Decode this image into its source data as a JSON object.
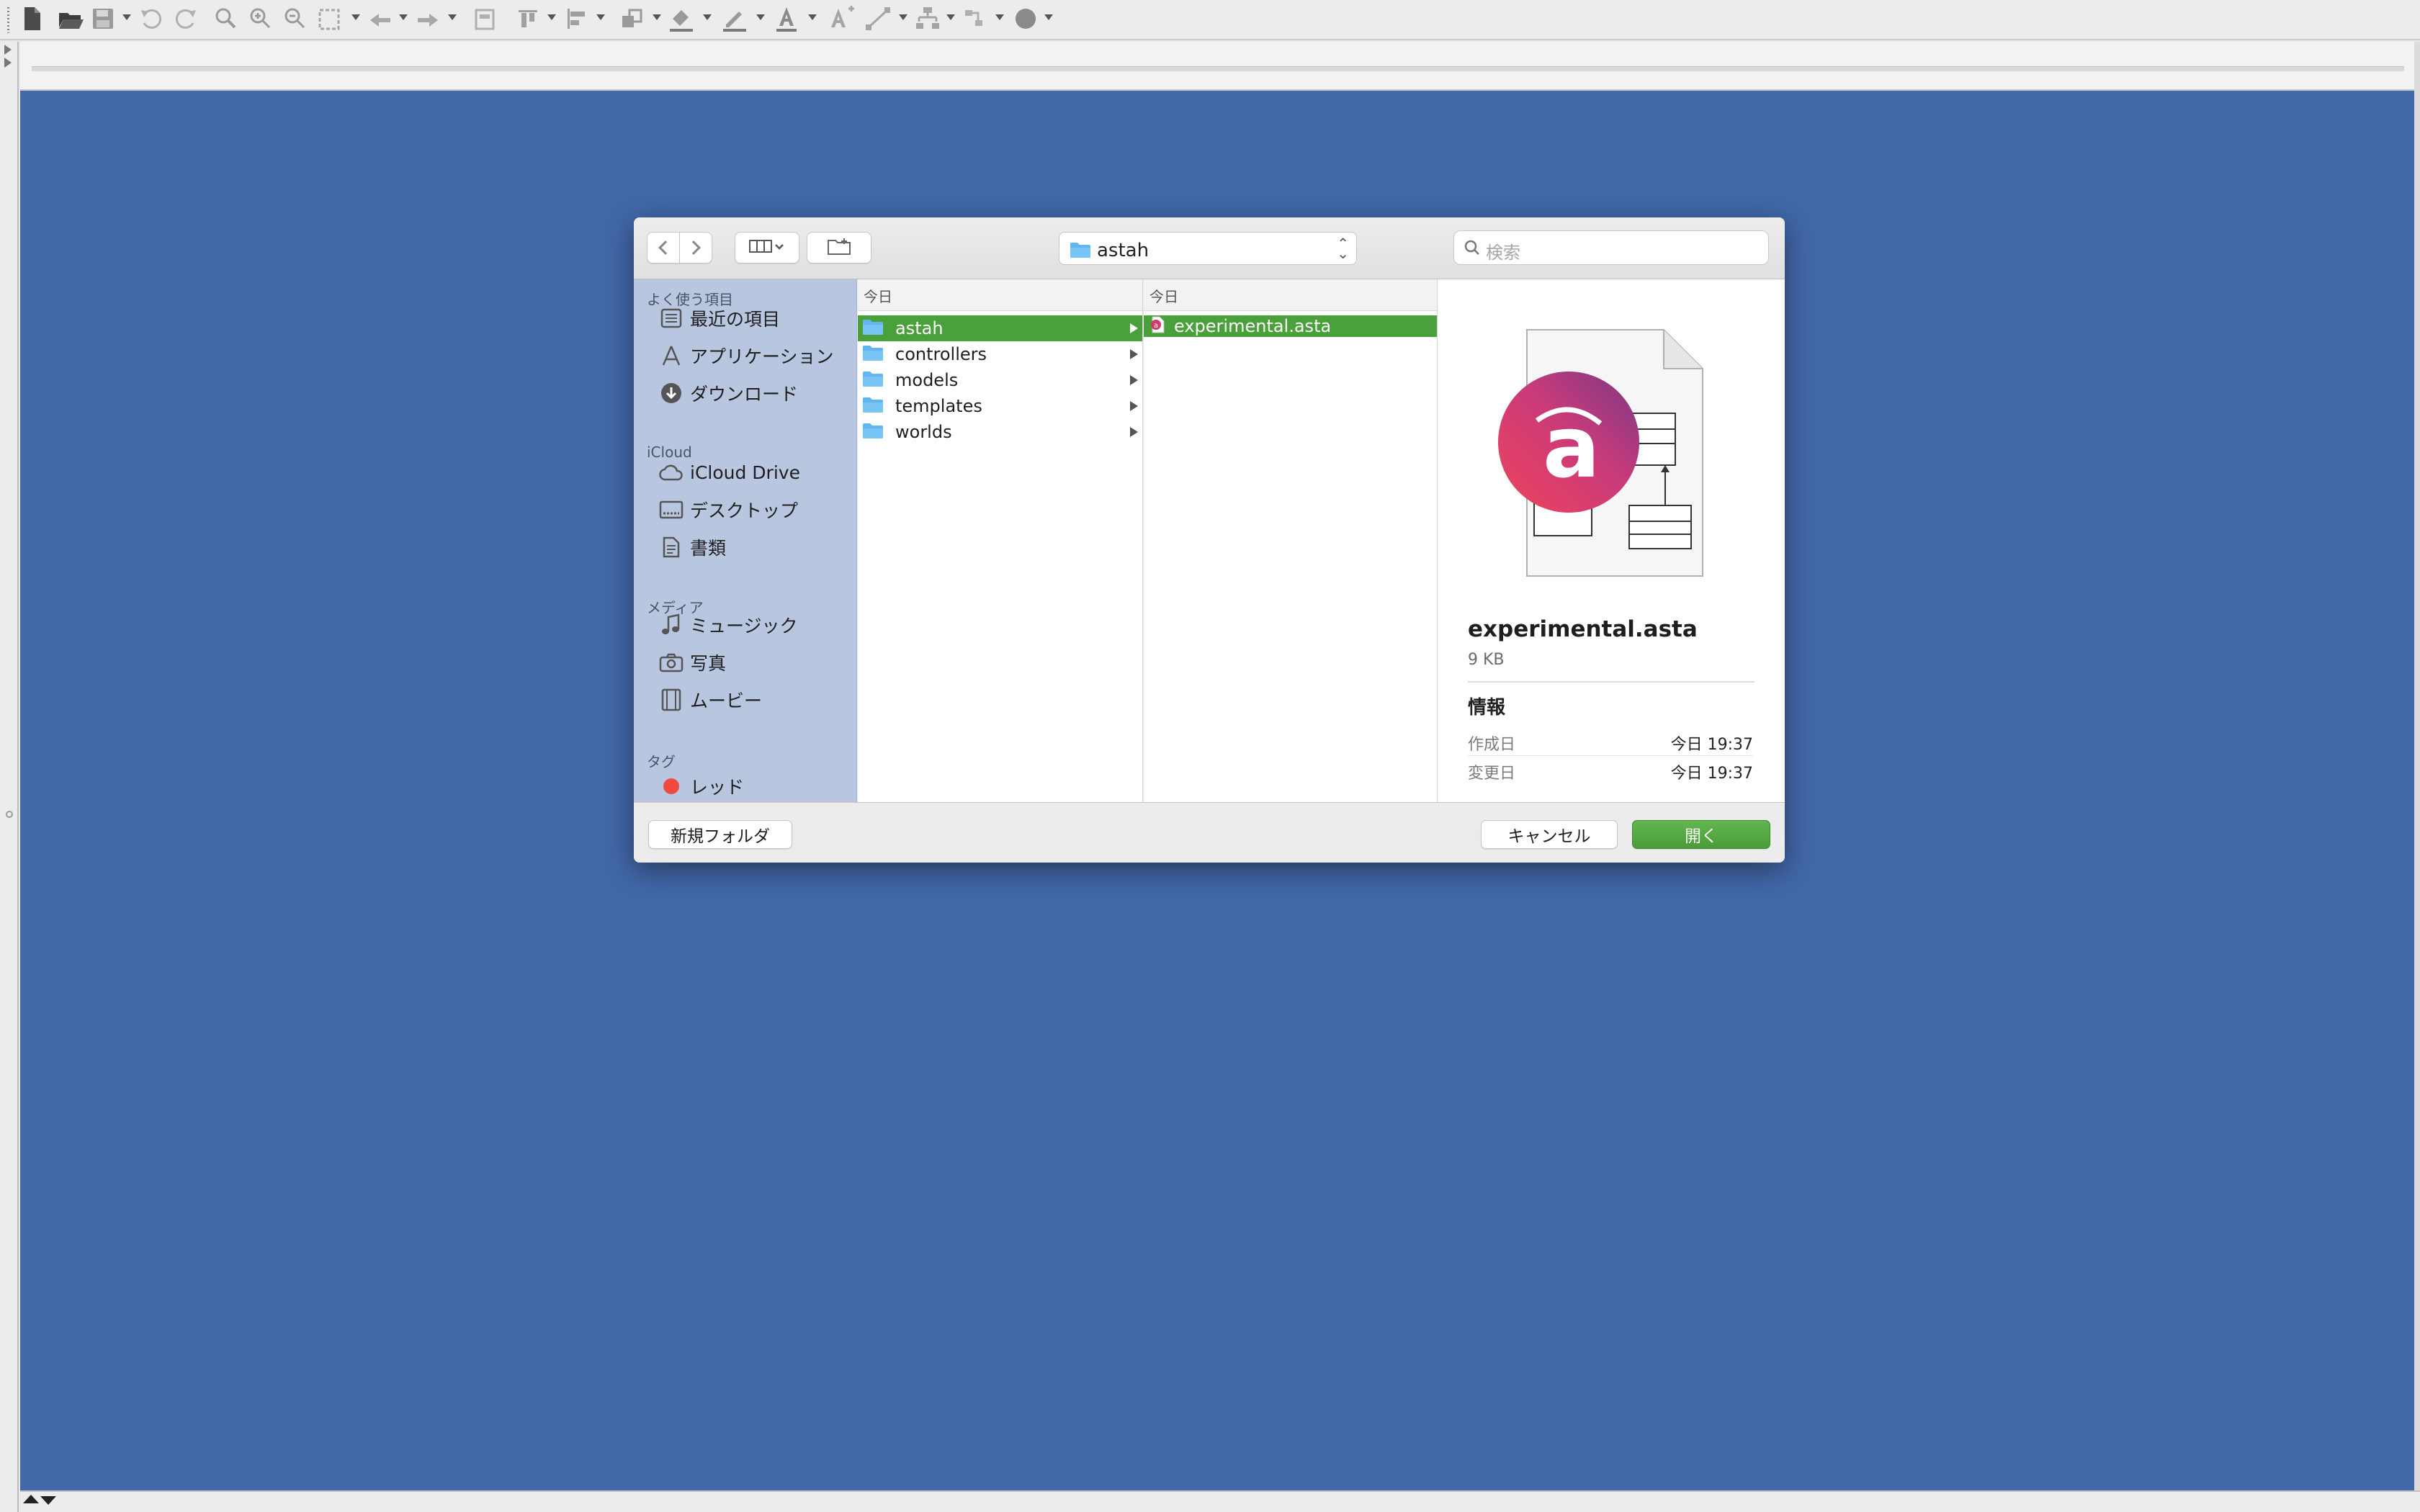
{
  "toolbar": {
    "icons": [
      "new-file-icon",
      "open-folder-icon",
      "save-icon",
      "undo-icon",
      "redo-icon",
      "zoom-icon",
      "zoom-in-icon",
      "zoom-out-icon",
      "fit-window-icon",
      "back-arrow-icon",
      "forward-arrow-icon",
      "grid-icon",
      "align-top-icon",
      "align-left-icon",
      "arrange-icon",
      "fill-color-icon",
      "line-color-icon",
      "font-color-icon",
      "font-size-icon",
      "line-style-icon",
      "layout-icon",
      "snap-icon",
      "shape-icon"
    ]
  },
  "dialog": {
    "current_folder": "astah",
    "search_placeholder": "検索",
    "sidebar": {
      "favorites_title": "よく使う項目",
      "favorites": [
        {
          "label": "最近の項目",
          "icon": "recents-icon"
        },
        {
          "label": "アプリケーション",
          "icon": "applications-icon"
        },
        {
          "label": "ダウンロード",
          "icon": "downloads-icon"
        }
      ],
      "icloud_title": "iCloud",
      "icloud": [
        {
          "label": "iCloud Drive",
          "icon": "cloud-icon"
        },
        {
          "label": "デスクトップ",
          "icon": "desktop-icon"
        },
        {
          "label": "書類",
          "icon": "documents-icon"
        }
      ],
      "media_title": "メディア",
      "media": [
        {
          "label": "ミュージック",
          "icon": "music-icon"
        },
        {
          "label": "写真",
          "icon": "camera-icon"
        },
        {
          "label": "ムービー",
          "icon": "movies-icon"
        }
      ],
      "tags_title": "タグ",
      "tags": [
        {
          "label": "レッド",
          "color": "#f04a3e"
        }
      ]
    },
    "column1": {
      "header": "今日",
      "items": [
        {
          "name": "astah",
          "selected": true
        },
        {
          "name": "controllers",
          "selected": false
        },
        {
          "name": "models",
          "selected": false
        },
        {
          "name": "templates",
          "selected": false
        },
        {
          "name": "worlds",
          "selected": false
        }
      ]
    },
    "column2": {
      "header": "今日",
      "items": [
        {
          "name": "experimental.asta",
          "selected": true
        }
      ]
    },
    "preview": {
      "file_name": "experimental.asta",
      "file_size": "9 KB",
      "info_title": "情報",
      "created_label": "作成日",
      "created_value": "今日 19:37",
      "modified_label": "変更日",
      "modified_value": "今日 19:37"
    },
    "buttons": {
      "new_folder": "新規フォルダ",
      "cancel": "キャンセル",
      "open": "開く"
    }
  },
  "colors": {
    "canvas": "#4268a9",
    "selection": "#4aa03a",
    "sidebar": "#b9c6df",
    "accent_primary": "#4a9c38"
  }
}
